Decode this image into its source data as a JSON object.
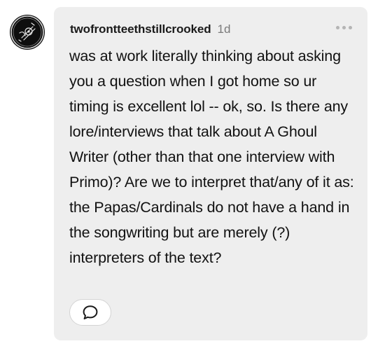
{
  "comment": {
    "username": "twofrontteethstillcrooked",
    "timestamp": "1d",
    "body": "was at work literally thinking about asking you a question when I got home so ur timing is excellent lol -- ok, so. Is there any lore/interviews that talk about A Ghoul Writer (other than that one interview with Primo)? Are we to interpret that/any of it as: the Papas/Cardinals do not have a hand in the songwriting but are merely (?) interpreters of the text?"
  },
  "icons": {
    "more": "more-horizontal-icon",
    "reply": "speech-bubble-icon",
    "avatar": "ghoul-emblem-avatar"
  },
  "colors": {
    "card_background": "#eeeeee",
    "avatar_background": "#111111",
    "text": "#111111",
    "muted": "#7a7a7a"
  }
}
